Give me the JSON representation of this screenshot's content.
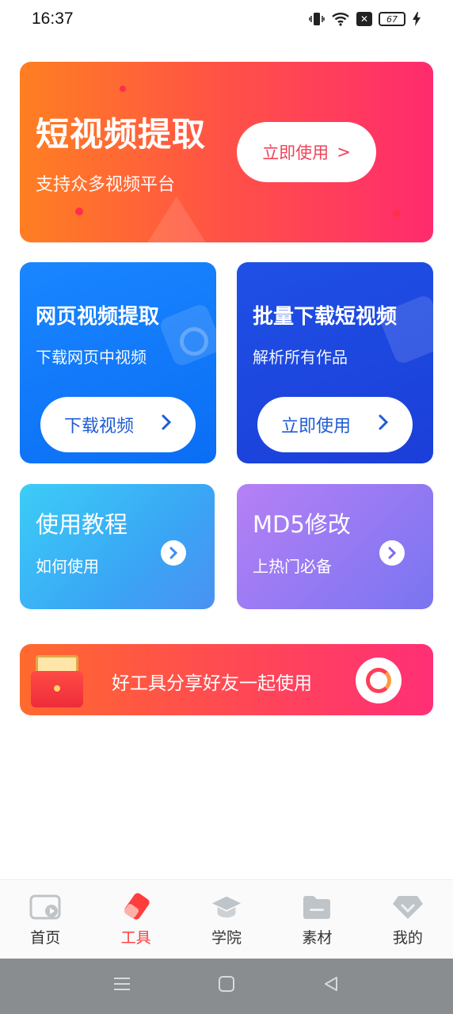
{
  "status_bar": {
    "time": "16:37",
    "battery": "67",
    "icons": [
      "vibrate-icon",
      "wifi-icon",
      "no-sim-icon",
      "battery-icon",
      "charging-icon"
    ]
  },
  "hero": {
    "title": "短视频提取",
    "subtitle": "支持众多视频平台",
    "button_label": "立即使用",
    "button_chevron": ">"
  },
  "web_card": {
    "title": "网页视频提取",
    "subtitle": "下载网页中视频",
    "button_label": "下载视频"
  },
  "batch_card": {
    "title": "批量下载短视频",
    "subtitle": "解析所有作品",
    "button_label": "立即使用"
  },
  "tutorial_card": {
    "title": "使用教程",
    "subtitle": "如何使用"
  },
  "md5_card": {
    "title": "MD5修改",
    "subtitle": "上热门必备"
  },
  "share_banner": {
    "text": "好工具分享好友一起使用"
  },
  "tabbar": {
    "items": [
      {
        "label": "首页",
        "icon": "play-video-icon",
        "active": false
      },
      {
        "label": "工具",
        "icon": "eraser-tool-icon",
        "active": true
      },
      {
        "label": "学院",
        "icon": "graduation-cap-icon",
        "active": false
      },
      {
        "label": "素材",
        "icon": "folder-icon",
        "active": false
      },
      {
        "label": "我的",
        "icon": "diamond-icon",
        "active": false
      }
    ]
  },
  "navbar": {
    "icons": [
      "menu-icon",
      "home-square-icon",
      "back-triangle-icon"
    ]
  },
  "colors": {
    "accent_red": "#ff3d3d",
    "hero_start": "#ff7f22",
    "hero_end": "#ff2b6e",
    "blue_card": "#0a6ef5",
    "deep_blue_card": "#1b3fd9",
    "cyan_card": "#3aa6f5",
    "purple_card": "#9179f3"
  }
}
